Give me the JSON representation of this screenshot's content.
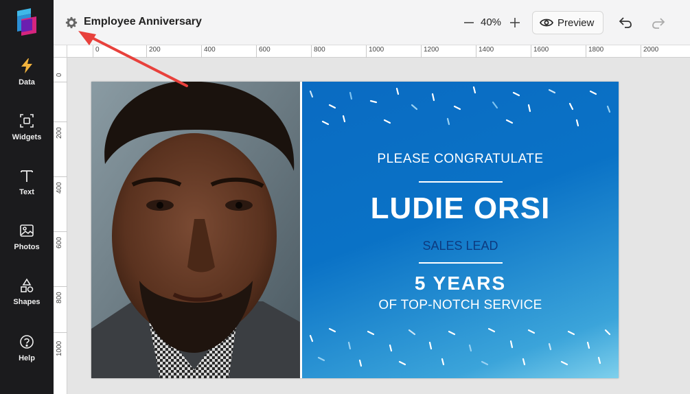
{
  "sidebar": {
    "items": [
      {
        "label": "Data",
        "icon": "lightning-icon"
      },
      {
        "label": "Widgets",
        "icon": "widgets-icon"
      },
      {
        "label": "Text",
        "icon": "text-icon"
      },
      {
        "label": "Photos",
        "icon": "image-icon"
      },
      {
        "label": "Shapes",
        "icon": "shapes-icon"
      },
      {
        "label": "Help",
        "icon": "help-icon"
      }
    ]
  },
  "topbar": {
    "title": "Employee Anniversary",
    "zoom": "40%",
    "preview_label": "Preview"
  },
  "ruler": {
    "h_ticks": [
      "0",
      "200",
      "400",
      "600",
      "800",
      "1000",
      "1200",
      "1400",
      "1600",
      "1800",
      "2000"
    ],
    "v_ticks": [
      "0",
      "200",
      "400",
      "600",
      "800",
      "1000"
    ]
  },
  "card": {
    "congrats": "PLEASE CONGRATULATE",
    "name": "LUDIE ORSI",
    "role": "SALES LEAD",
    "years": "5 YEARS",
    "service": "OF TOP-NOTCH SERVICE"
  },
  "colors": {
    "sidebar_bg": "#1b1b1d",
    "panel_blue": "#0a6bc2",
    "role_text": "#0d3b80",
    "annotation_red": "#e8413c"
  }
}
